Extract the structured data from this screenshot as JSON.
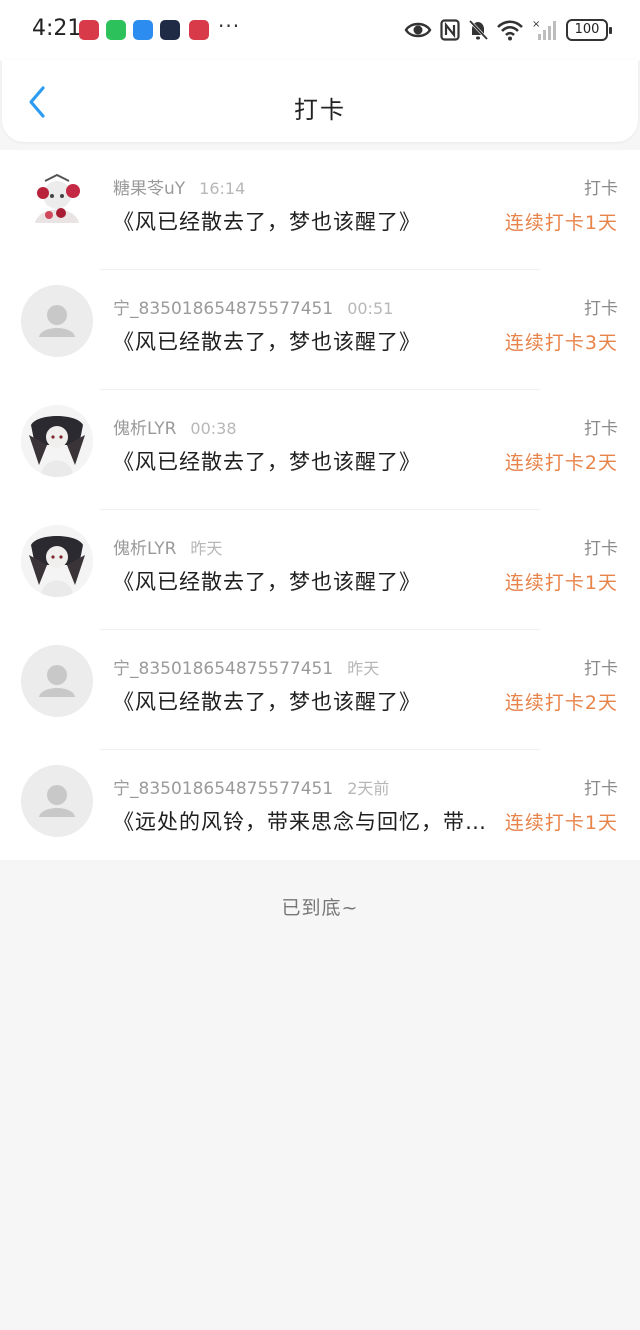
{
  "status_bar": {
    "time": "4:21",
    "more": "···",
    "battery": "100",
    "apps": [
      {
        "icon": "huawei-app-icon",
        "color": "#d93a4a"
      },
      {
        "icon": "wechat-icon",
        "color": "#2dc15b"
      },
      {
        "icon": "blue-app-icon",
        "color": "#2d8cf0"
      },
      {
        "icon": "video-app-icon",
        "color": "#1f2a44"
      },
      {
        "icon": "huawei-app-icon",
        "color": "#d93a4a"
      }
    ]
  },
  "header": {
    "title": "打卡",
    "back_icon": "chevron-left-icon",
    "accent": "#2d9cf0"
  },
  "records": [
    {
      "user": "糖果苓uY",
      "time": "16:14",
      "content": "《风已经散去了，梦也该醒了》",
      "label": "打卡",
      "streak": "连续打卡1天",
      "avatar": "anime-red"
    },
    {
      "user": "宁_835018654875577451",
      "time": "00:51",
      "content": "《风已经散去了，梦也该醒了》",
      "label": "打卡",
      "streak": "连续打卡3天",
      "avatar": "default"
    },
    {
      "user": "傀析LYR",
      "time": "00:38",
      "content": "《风已经散去了，梦也该醒了》",
      "label": "打卡",
      "streak": "连续打卡2天",
      "avatar": "anime-dark"
    },
    {
      "user": "傀析LYR",
      "time": "昨天",
      "content": "《风已经散去了，梦也该醒了》",
      "label": "打卡",
      "streak": "连续打卡1天",
      "avatar": "anime-dark"
    },
    {
      "user": "宁_835018654875577451",
      "time": "昨天",
      "content": "《风已经散去了，梦也该醒了》",
      "label": "打卡",
      "streak": "连续打卡2天",
      "avatar": "default"
    },
    {
      "user": "宁_835018654875577451",
      "time": "2天前",
      "content": "《远处的风铃，带来思念与回忆，带来风的消息》",
      "label": "打卡",
      "streak": "连续打卡1天",
      "avatar": "default"
    }
  ],
  "footer": {
    "end_text": "已到底~"
  },
  "colors": {
    "streak": "#e8834a",
    "meta": "#9a9a9a",
    "background": "#f7f6f7"
  }
}
